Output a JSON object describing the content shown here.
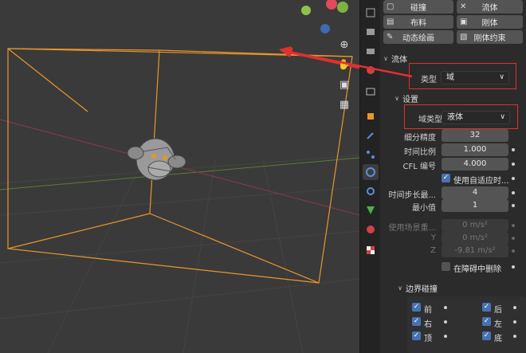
{
  "physics_buttons": {
    "collision": "碰撞",
    "fluid": "流体",
    "cloth": "布料",
    "rigid_body": "刚体",
    "dynamic_paint": "动态绘画",
    "rigid_body_constraint": "刚体约束"
  },
  "fluid_section": {
    "title": "流体",
    "type_label": "类型",
    "type_value": "域"
  },
  "settings_section": {
    "title": "设置",
    "domain_type_label": "域类型",
    "domain_type_value": "液体",
    "resolution_label": "细分精度",
    "resolution_value": "32",
    "time_scale_label": "时间比例",
    "time_scale_value": "1.000",
    "cfl_label": "CFL 编号",
    "cfl_value": "4.000",
    "adaptive_label": "使用自适应时...",
    "timesteps_max_label": "时间步长最...",
    "timesteps_max_value": "4",
    "timesteps_min_label": "最小值",
    "timesteps_min_value": "1",
    "gravity_label": "使用场景重...",
    "gravity_x": "0 m/s²",
    "gravity_y_label": "Y",
    "gravity_y": "0 m/s²",
    "gravity_z_label": "Z",
    "gravity_z": "-9.81 m/s²",
    "delete_in_obstacle_label": "在障碍中删除"
  },
  "border_section": {
    "title": "边界碰撞",
    "front": "前",
    "back": "后",
    "right": "右",
    "left": "左",
    "top": "顶",
    "bottom": "底"
  },
  "colors": {
    "accent": "#4772b3",
    "domain_box": "#e8962c",
    "highlight": "#e03030"
  }
}
